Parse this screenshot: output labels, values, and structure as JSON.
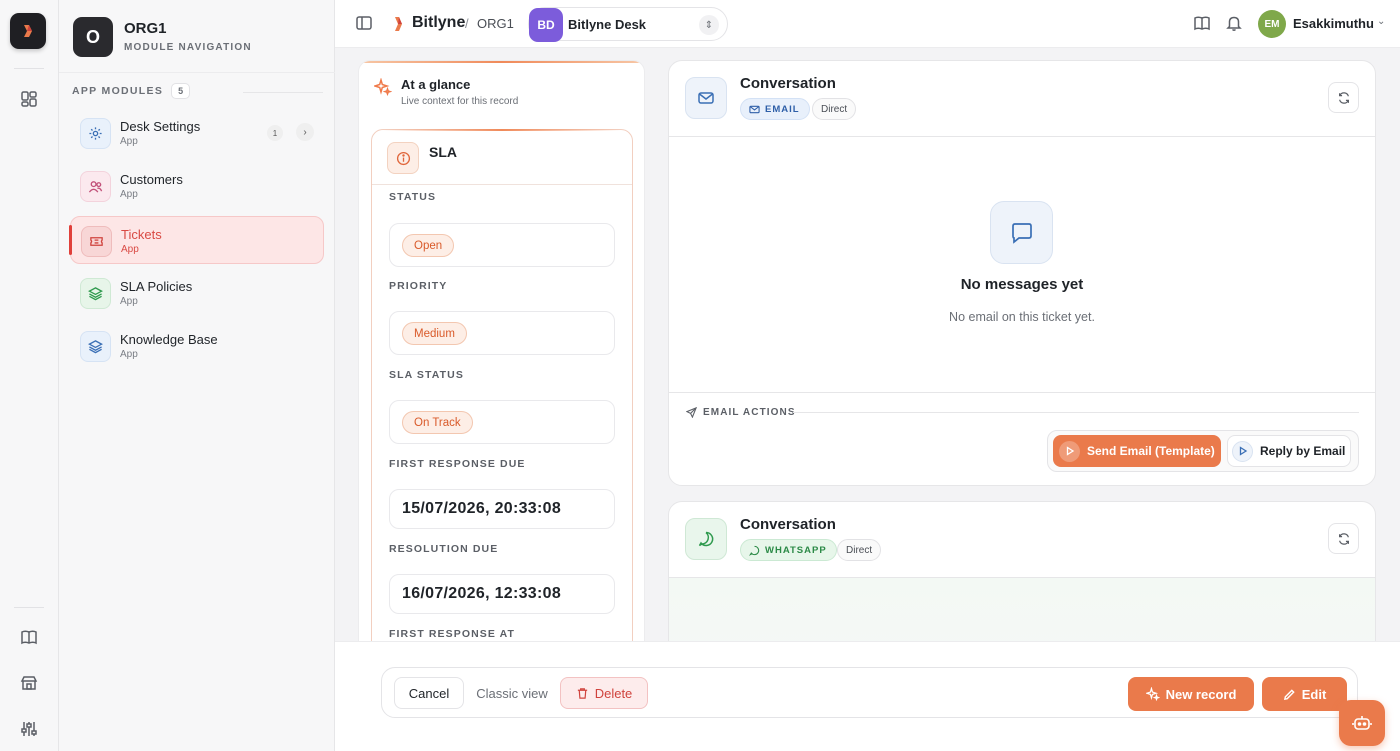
{
  "org": {
    "avatar": "O",
    "name": "ORG1",
    "subtitle": "MODULE NAVIGATION"
  },
  "modules": {
    "heading": "APP MODULES",
    "count": "5",
    "items": [
      {
        "label": "Desk Settings",
        "sub": "App",
        "badge": "1",
        "chevron": "›"
      },
      {
        "label": "Customers",
        "sub": "App"
      },
      {
        "label": "Tickets",
        "sub": "App"
      },
      {
        "label": "SLA Policies",
        "sub": "App"
      },
      {
        "label": "Knowledge Base",
        "sub": "App"
      }
    ]
  },
  "topbar": {
    "brand": "Bitlyne",
    "separator": "/",
    "org": "ORG1",
    "switcher": {
      "avatar": "BD",
      "label": "Bitlyne Desk",
      "arrow": "⇕"
    },
    "user": {
      "initials": "EM",
      "name": "Esakkimuthu",
      "chevron": "⌄"
    }
  },
  "glance": {
    "title": "At a glance",
    "subtitle": "Live context for this record",
    "sla": {
      "title": "SLA",
      "fields": [
        {
          "label": "STATUS",
          "chip": "Open"
        },
        {
          "label": "PRIORITY",
          "chip": "Medium"
        },
        {
          "label": "SLA STATUS",
          "chip": "On Track"
        },
        {
          "label": "FIRST RESPONSE DUE",
          "value": "15/07/2026, 20:33:08"
        },
        {
          "label": "RESOLUTION DUE",
          "value": "16/07/2026, 12:33:08"
        },
        {
          "label": "FIRST RESPONSE AT"
        }
      ]
    }
  },
  "conversation_email": {
    "title": "Conversation",
    "tag": "EMAIL",
    "direction": "Direct",
    "empty_title": "No messages yet",
    "empty_sub": "No email on this ticket yet.",
    "actions_label": "EMAIL ACTIONS",
    "send_template": "Send Email (Template)",
    "reply_email": "Reply by Email"
  },
  "conversation_whatsapp": {
    "title": "Conversation",
    "tag": "WHATSAPP",
    "direction": "Direct"
  },
  "footer": {
    "cancel": "Cancel",
    "classic": "Classic view",
    "delete": "Delete",
    "new_record": "New record",
    "edit": "Edit"
  },
  "colors": {
    "accent": "#ea7a4b",
    "active_module": "#d94a44",
    "avatar_bd": "#7c5cdb",
    "avatar_em": "#7fa84a"
  },
  "icons": [
    "app-logo-icon",
    "dashboard-grid-icon",
    "book-icon",
    "store-icon",
    "sliders-icon",
    "sidebar-toggle-icon",
    "docs-icon",
    "bell-icon",
    "mail-icon",
    "chat-icon",
    "refresh-icon",
    "send-icon",
    "play-icon",
    "trash-icon",
    "sparkle-icon",
    "pencil-icon",
    "bot-icon",
    "info-icon"
  ]
}
